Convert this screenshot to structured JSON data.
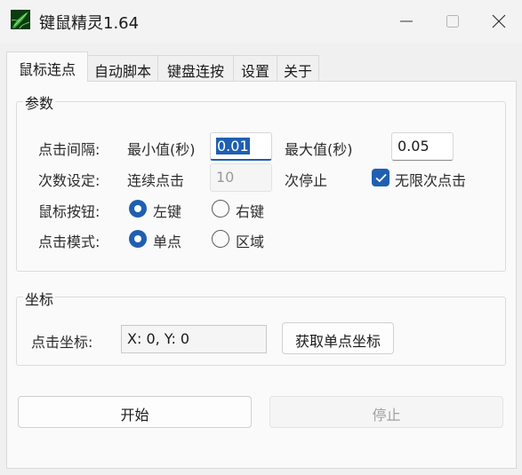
{
  "window": {
    "title": "键鼠精灵1.64",
    "icon": "leaf-app-icon",
    "controls": [
      "minimize-icon",
      "maximize-icon",
      "close-icon"
    ]
  },
  "tabs": [
    {
      "label": "鼠标连点",
      "active": true
    },
    {
      "label": "自动脚本",
      "active": false
    },
    {
      "label": "键盘连按",
      "active": false
    },
    {
      "label": "设置",
      "active": false
    },
    {
      "label": "关于",
      "active": false
    }
  ],
  "params": {
    "group_title": "参数",
    "click_interval": {
      "label": "点击间隔:",
      "min_label": "最小值(秒)",
      "min_value": "0.01",
      "max_label": "最大值(秒)",
      "max_value": "0.05"
    },
    "count": {
      "label": "次数设定:",
      "prefix": "连续点击",
      "value": "10",
      "suffix": "次停止",
      "infinite_label": "无限次点击",
      "infinite_checked": true
    },
    "mouse_button": {
      "label": "鼠标按钮:",
      "options": [
        "左键",
        "右键"
      ],
      "selected": "左键"
    },
    "click_mode": {
      "label": "点击模式:",
      "options": [
        "单点",
        "区域"
      ],
      "selected": "单点"
    }
  },
  "coords": {
    "group_title": "坐标",
    "label": "点击坐标:",
    "value": "X: 0, Y: 0",
    "get_button": "获取单点坐标"
  },
  "actions": {
    "start": "开始",
    "stop": "停止"
  },
  "colors": {
    "accent": "#1f5fb2",
    "panel": "#fafafa",
    "window": "#f0f0f0"
  }
}
